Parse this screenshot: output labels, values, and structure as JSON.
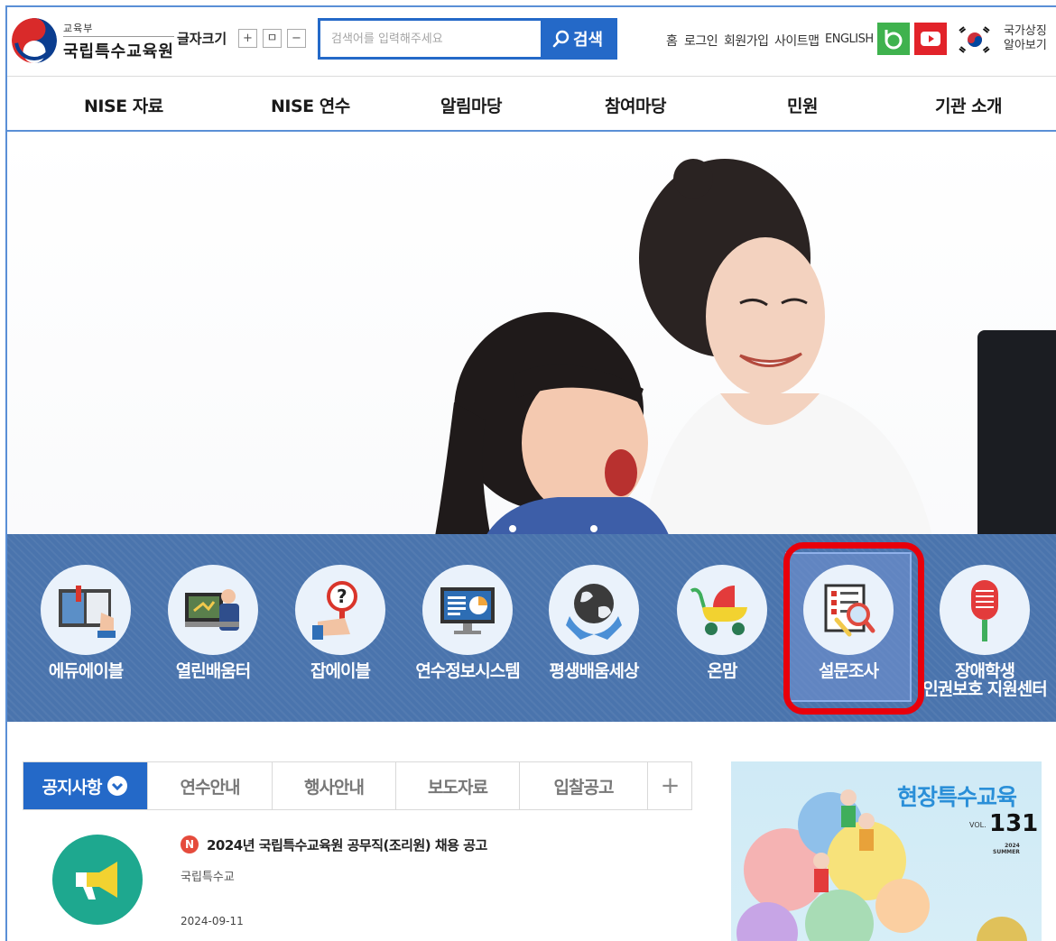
{
  "header": {
    "logo_ministry": "교육부",
    "logo_name": "국립특수교육원",
    "font_size_label": "글자크기",
    "font_size_buttons": [
      "+",
      "ㅁ",
      "−"
    ],
    "search_placeholder": "검색어를 입력해주세요",
    "search_button": "검색",
    "utility_links": [
      "홈",
      "로그인",
      "회원가입",
      "사이트맵",
      "ENGLISH"
    ],
    "national_symbol": [
      "국가상징",
      "알아보기"
    ]
  },
  "nav": {
    "items": [
      "NISE 자료",
      "NISE 연수",
      "알림마당",
      "참여마당",
      "민원",
      "기관 소개"
    ]
  },
  "quick_links": [
    {
      "label": "에듀에이블",
      "icon": "book-icon"
    },
    {
      "label": "열린배움터",
      "icon": "teacher-board-icon"
    },
    {
      "label": "잡에이블",
      "icon": "job-question-icon"
    },
    {
      "label": "연수정보시스템",
      "icon": "monitor-chart-icon"
    },
    {
      "label": "평생배움세상",
      "icon": "globe-hands-icon"
    },
    {
      "label": "온맘",
      "icon": "stroller-icon"
    },
    {
      "label": "설문조사",
      "icon": "survey-magnifier-icon"
    },
    {
      "label_lines": [
        "장애학생",
        "인권보호 지원센터"
      ],
      "icon": "microphone-icon"
    }
  ],
  "tabs": {
    "items": [
      "공지사항",
      "연수안내",
      "행사안내",
      "보도자료",
      "입찰공고"
    ],
    "active": "공지사항",
    "more": "+"
  },
  "notice": {
    "badge": "N",
    "title": "2024년 국립특수교육원 공무직(조리원) 채용 공고",
    "source": "국립특수교",
    "date": "2024-09-11"
  },
  "banner": {
    "title": "현장특수교육",
    "vol_label": "VOL.",
    "vol_number": "131",
    "year": "2024",
    "season": "SUMMER"
  },
  "colors": {
    "brand_blue": "#2469c8",
    "quick_bar": "#4a74ad",
    "highlight_red": "#e8000b",
    "notice_green": "#1ea88f"
  }
}
